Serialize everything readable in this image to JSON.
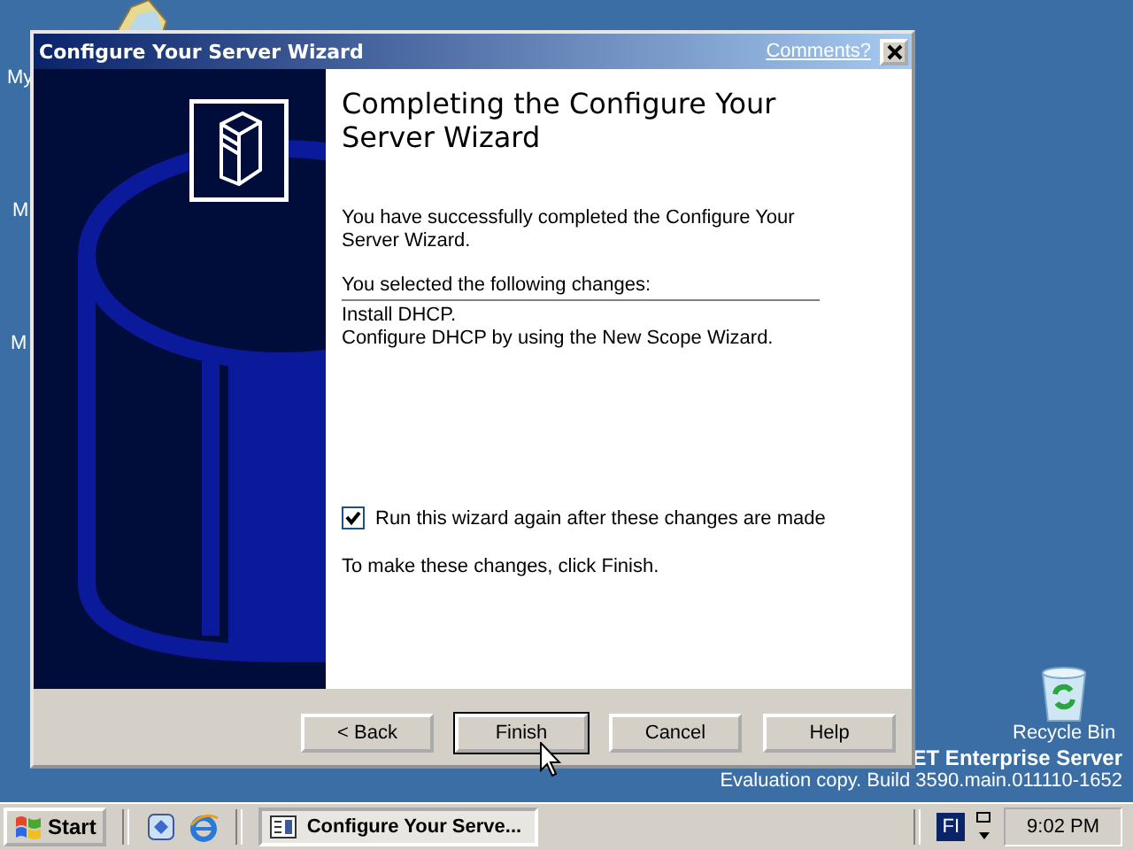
{
  "desktop": {
    "icon_labels": [
      "My",
      "M",
      "M"
    ],
    "recycle_bin": {
      "label": "Recycle Bin"
    },
    "version_lines": [
      "ET Enterprise Server",
      "Evaluation copy. Build 3590.main.011110-1652"
    ]
  },
  "window": {
    "title": "Configure Your Server Wizard",
    "comments_link": "Comments?"
  },
  "page": {
    "heading": "Completing the Configure Your Server Wizard",
    "intro": "You have successfully completed the Configure Your Server Wizard.",
    "changes_label": "You selected the following changes:",
    "changes": [
      "Install DHCP.",
      "Configure DHCP by using the New Scope Wizard."
    ],
    "rerun_checkbox": {
      "label": "Run this wizard again after these changes are made",
      "checked": true
    },
    "footer_text": "To make these changes, click Finish."
  },
  "buttons": [
    {
      "label": "< Back",
      "default": false
    },
    {
      "label": "Finish",
      "default": true
    },
    {
      "label": "Cancel",
      "default": false
    },
    {
      "label": "Help",
      "default": false
    }
  ],
  "taskbar": {
    "start": "Start",
    "tasks": [
      {
        "label": "Configure Your Serve...",
        "selected": true
      }
    ],
    "language": "FI",
    "clock": "9:02 PM"
  }
}
